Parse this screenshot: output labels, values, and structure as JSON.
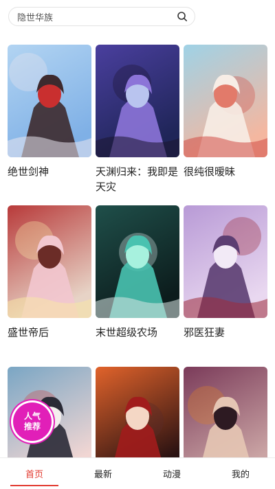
{
  "search": {
    "placeholder": "隐世华族"
  },
  "comics": [
    {
      "title": "绝世剑神",
      "palette": [
        "#7fb0e6",
        "#b2d4f2",
        "#3d2a2e",
        "#c92f2f",
        "#eae6ef"
      ]
    },
    {
      "title": "天渊归来：我即是天灾",
      "palette": [
        "#1f2558",
        "#4a3f9e",
        "#8c74d8",
        "#b9c4ef",
        "#1c1530"
      ]
    },
    {
      "title": "很纯很暧昧",
      "palette": [
        "#f4b7a0",
        "#9fd2e6",
        "#f7ede6",
        "#e27a6a",
        "#d24d46"
      ]
    },
    {
      "title": "盛世帝后",
      "palette": [
        "#e7d3c6",
        "#b83a3a",
        "#f2c7cf",
        "#6b2c27",
        "#f7e6a6"
      ]
    },
    {
      "title": "末世超级农场",
      "palette": [
        "#0c1c1c",
        "#1f4f4a",
        "#49c2b0",
        "#a7f1de",
        "#d8e6e4"
      ]
    },
    {
      "title": "邪医狂妻",
      "palette": [
        "#e9d8f0",
        "#b89ad6",
        "#5c3e72",
        "#f2eaf6",
        "#9d2b3a"
      ]
    },
    {
      "title": "",
      "palette": [
        "#f1d6d3",
        "#7aa6c4",
        "#2a2a36",
        "#f4f0ee",
        "#c64a4a"
      ]
    },
    {
      "title": "",
      "palette": [
        "#2a1212",
        "#e1632b",
        "#a11c1c",
        "#f4d7c5",
        "#5a2a2a"
      ]
    },
    {
      "title": "",
      "palette": [
        "#caa4a4",
        "#7b3b5a",
        "#e5c6b4",
        "#2d1a22",
        "#d97d2a"
      ]
    }
  ],
  "badge": {
    "line1": "人气",
    "line2": "推荐"
  },
  "tabs": [
    {
      "label": "首页",
      "active": true
    },
    {
      "label": "最新",
      "active": false
    },
    {
      "label": "动漫",
      "active": false
    },
    {
      "label": "我的",
      "active": false
    }
  ]
}
